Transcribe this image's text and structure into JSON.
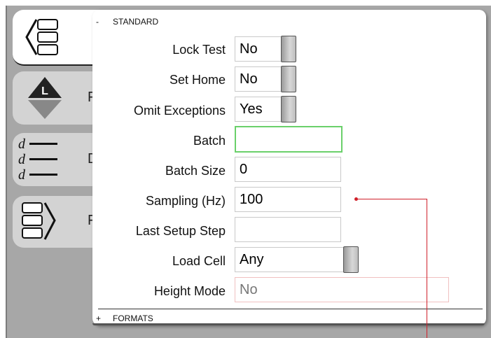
{
  "sidebar": {
    "tabs": [
      {
        "name": "layout",
        "letter": ""
      },
      {
        "name": "limits",
        "letter": "F",
        "icon_letter": "L"
      },
      {
        "name": "data",
        "letter": "D",
        "icon_letters": [
          "d",
          "d",
          "d"
        ]
      },
      {
        "name": "export",
        "letter": "F"
      }
    ]
  },
  "panel": {
    "standard_section": {
      "toggle": "-",
      "title": "STANDARD"
    },
    "formats_section": {
      "toggle": "+",
      "title": "FORMATS"
    },
    "fields": [
      {
        "label": "Lock Test",
        "value": "No"
      },
      {
        "label": "Set Home",
        "value": "No"
      },
      {
        "label": "Omit Exceptions",
        "value": "Yes"
      },
      {
        "label": "Batch",
        "value": ""
      },
      {
        "label": "Batch Size",
        "value": "0"
      },
      {
        "label": "Sampling (Hz)",
        "value": "100"
      },
      {
        "label": "Last Setup Step",
        "value": ""
      },
      {
        "label": "Load Cell",
        "value": "Any"
      },
      {
        "label": "Height Mode",
        "value": "No"
      }
    ]
  },
  "colors": {
    "background": "#a7a7a7",
    "tab": "#d3d3d3",
    "focus_border": "#6ad06a",
    "readonly_border": "#f0c0c0",
    "annotation_line": "#d0202a"
  }
}
